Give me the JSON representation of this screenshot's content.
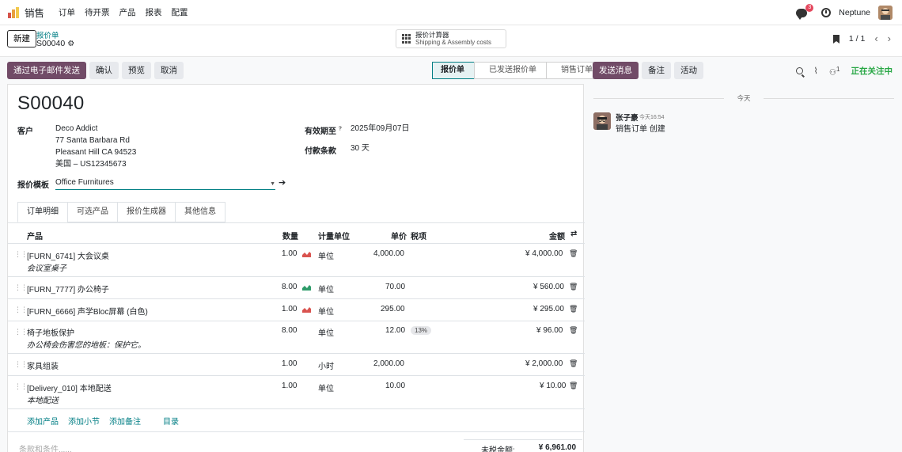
{
  "nav": {
    "app_name": "销售",
    "menu": [
      "订单",
      "待开票",
      "产品",
      "报表",
      "配置"
    ],
    "chat_badge": "3",
    "company": "Neptune"
  },
  "control": {
    "new_button": "新建",
    "breadcrumb_parent": "报价单",
    "breadcrumb_current": "S00040",
    "smart_button_title": "报价计算器",
    "smart_button_sub": "Shipping & Assembly costs",
    "pager": "1 / 1"
  },
  "actions": {
    "send_email": "通过电子邮件发送",
    "confirm": "确认",
    "preview": "预览",
    "cancel": "取消"
  },
  "status_stages": [
    "报价单",
    "已发送报价单",
    "销售订单"
  ],
  "chatter_actions": {
    "send_message": "发送消息",
    "log_note": "备注",
    "activity": "活动",
    "follower_count": "1",
    "following": "正在关注中"
  },
  "form": {
    "title": "S00040",
    "customer_label": "客户",
    "customer_name": "Deco Addict",
    "customer_addr1": "77 Santa Barbara Rd",
    "customer_addr2": "Pleasant Hill CA 94523",
    "customer_addr3": "美国 – US12345673",
    "expiration_label": "有效期至",
    "expiration_help": "?",
    "expiration_value": "2025年09月07日",
    "payment_terms_label": "付款条款",
    "payment_terms_value": "30 天",
    "template_label": "报价模板",
    "template_value": "Office Furnitures"
  },
  "tabs": [
    "订单明细",
    "可选产品",
    "报价生成器",
    "其他信息"
  ],
  "table": {
    "headers": {
      "product": "产品",
      "qty": "数量",
      "uom": "计量单位",
      "price": "单价",
      "taxes": "税项",
      "amount": "金额"
    },
    "rows": [
      {
        "product": "[FURN_6741] 大会议桌",
        "desc": "会议室桌子",
        "qty": "1.00",
        "forecast": "red",
        "uom": "单位",
        "price": "4,000.00",
        "tax": "",
        "amount": "¥ 4,000.00"
      },
      {
        "product": "[FURN_7777] 办公椅子",
        "desc": "",
        "qty": "8.00",
        "forecast": "green",
        "uom": "单位",
        "price": "70.00",
        "tax": "",
        "amount": "¥ 560.00"
      },
      {
        "product": "[FURN_6666] 声学Bloc屏幕 (白色)",
        "desc": "",
        "qty": "1.00",
        "forecast": "red",
        "uom": "单位",
        "price": "295.00",
        "tax": "",
        "amount": "¥ 295.00"
      },
      {
        "product": "椅子地板保护",
        "desc": "办公椅会伤害您的地板：保护它。",
        "qty": "8.00",
        "forecast": "",
        "uom": "单位",
        "price": "12.00",
        "tax": "13%",
        "amount": "¥ 96.00"
      },
      {
        "product": "家具组装",
        "desc": "",
        "qty": "1.00",
        "forecast": "",
        "uom": "小时",
        "price": "2,000.00",
        "tax": "",
        "amount": "¥ 2,000.00"
      },
      {
        "product": "[Delivery_010] 本地配送",
        "desc": "本地配送",
        "qty": "1.00",
        "forecast": "",
        "uom": "单位",
        "price": "10.00",
        "tax": "",
        "amount": "¥ 10.00"
      }
    ],
    "add_links": [
      "添加产品",
      "添加小节",
      "添加备注",
      "目录"
    ]
  },
  "footer": {
    "terms_placeholder": "条款和条件......",
    "untaxed_label": "未税金额:",
    "untaxed_value": "¥ 6,961.00"
  },
  "chatter": {
    "date_sep": "今天",
    "author": "张子豪",
    "time": "今天16:54",
    "body": "销售订单 创建"
  },
  "colors": {
    "primary": "#714b67",
    "accent": "#017e84",
    "following": "#28a745",
    "forecast_red": "#d9534f",
    "forecast_green": "#2e9c6a"
  }
}
